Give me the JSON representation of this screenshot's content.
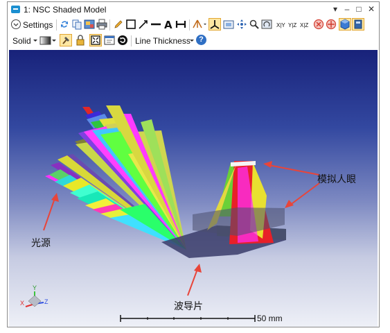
{
  "window": {
    "title": "1: NSC Shaded Model"
  },
  "window_controls": {
    "menu": "▾",
    "minimize": "–",
    "maximize": "□",
    "close": "✕"
  },
  "toolbar1": {
    "settings_label": "Settings",
    "axis_labels": {
      "xy": "X|Y",
      "yz": "Y|Z",
      "xz": "X|Z"
    }
  },
  "toolbar2": {
    "solid_label": "Solid",
    "line_thickness_label": "Line Thickness",
    "help_label": "?"
  },
  "viewport": {
    "annotations": {
      "human_eye": "模拟人眼",
      "light_source": "光源",
      "waveguide": "波导片"
    },
    "scale_bar": {
      "label": "50 mm"
    },
    "axes": {
      "x": "X",
      "y": "Y",
      "z": "Z"
    }
  },
  "colors": {
    "title_icon": "#1c8fd0",
    "viewport_top": "#18227a",
    "viewport_bottom": "#eef0f7",
    "annotation_arrow": "#e8453a"
  }
}
